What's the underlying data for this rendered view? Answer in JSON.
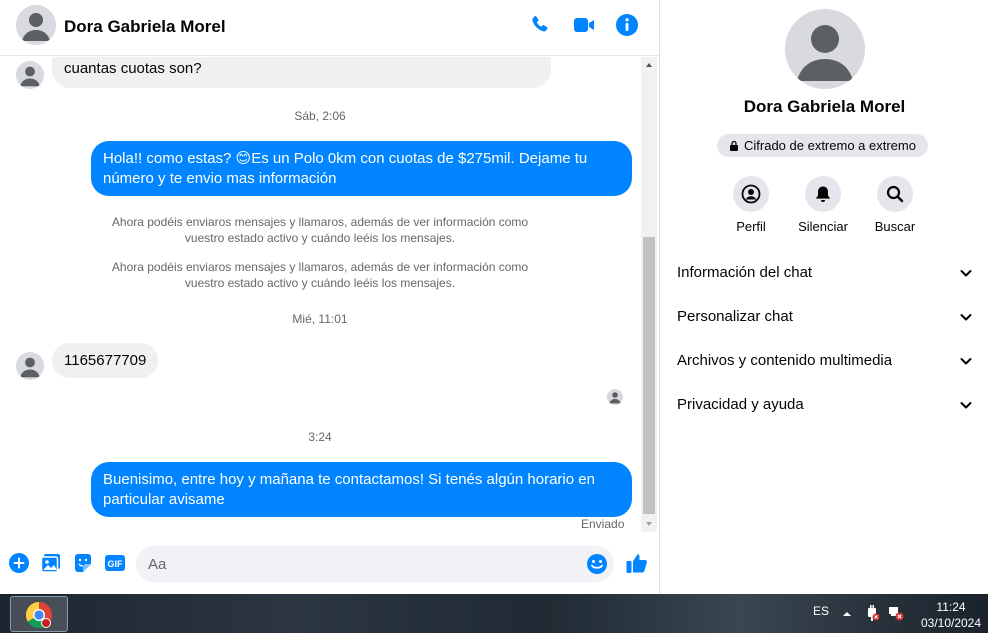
{
  "chat": {
    "contact_name": "Dora Gabriela Morel",
    "messages": {
      "partial_incoming": "cuantas cuotas son?",
      "time_1": "Sáb, 2:06",
      "outgoing_1": "Hola!! como estas? 😊Es un Polo 0km con cuotas de $275mil. Dejame tu número y te envio mas información",
      "system_1": "Ahora podéis enviaros mensajes y llamaros, además de ver información como vuestro estado activo y cuándo leéis los mensajes.",
      "system_2": "Ahora podéis enviaros mensajes y llamaros, además de ver información como vuestro estado activo y cuándo leéis los mensajes.",
      "time_2": "Mié, 11:01",
      "incoming_1": "1165677709",
      "time_3": "3:24",
      "outgoing_2": "Buenisimo, entre hoy y mañana te contactamos! Si tenés algún horario en particular avisame",
      "status": "Enviado"
    },
    "composer": {
      "placeholder": "Aa"
    },
    "colors": {
      "accent": "#0084ff",
      "incoming_bubble": "#f0f0f0"
    }
  },
  "info": {
    "name": "Dora Gabriela Morel",
    "encryption_badge": "Cifrado de extremo a extremo",
    "actions": [
      {
        "label": "Perfil",
        "icon": "profile-icon"
      },
      {
        "label": "Silenciar",
        "icon": "bell-icon"
      },
      {
        "label": "Buscar",
        "icon": "search-icon"
      }
    ],
    "sections": [
      {
        "label": "Información del chat"
      },
      {
        "label": "Personalizar chat"
      },
      {
        "label": "Archivos y contenido multimedia"
      },
      {
        "label": "Privacidad y ayuda"
      }
    ]
  },
  "taskbar": {
    "language": "ES",
    "time": "11:24",
    "date": "03/10/2024"
  }
}
